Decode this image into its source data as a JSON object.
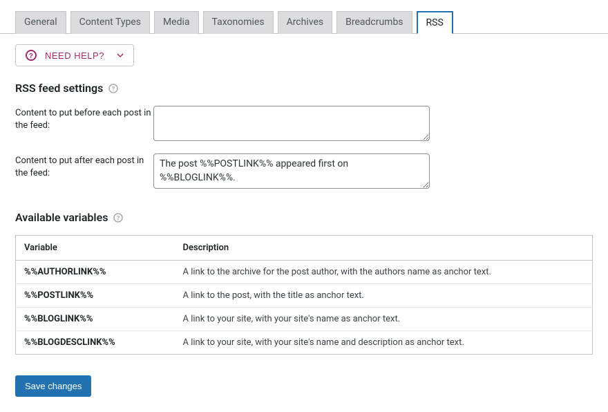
{
  "tabs": {
    "general": "General",
    "content_types": "Content Types",
    "media": "Media",
    "taxonomies": "Taxonomies",
    "archives": "Archives",
    "breadcrumbs": "Breadcrumbs",
    "rss": "RSS"
  },
  "help_button": {
    "label": "NEED HELP?"
  },
  "sections": {
    "rss_feed": {
      "title": "RSS feed settings",
      "before_label": "Content to put before each post in the feed:",
      "before_value": "",
      "after_label": "Content to put after each post in the feed:",
      "after_value": "The post %%POSTLINK%% appeared first on %%BLOGLINK%%."
    },
    "variables": {
      "title": "Available variables",
      "headers": {
        "variable": "Variable",
        "description": "Description"
      },
      "rows": [
        {
          "variable": "%%AUTHORLINK%%",
          "description": "A link to the archive for the post author, with the authors name as anchor text."
        },
        {
          "variable": "%%POSTLINK%%",
          "description": "A link to the post, with the title as anchor text."
        },
        {
          "variable": "%%BLOGLINK%%",
          "description": "A link to your site, with your site's name as anchor text."
        },
        {
          "variable": "%%BLOGDESCLINK%%",
          "description": "A link to your site, with your site's name and description as anchor text."
        }
      ]
    }
  },
  "save_button": "Save changes"
}
